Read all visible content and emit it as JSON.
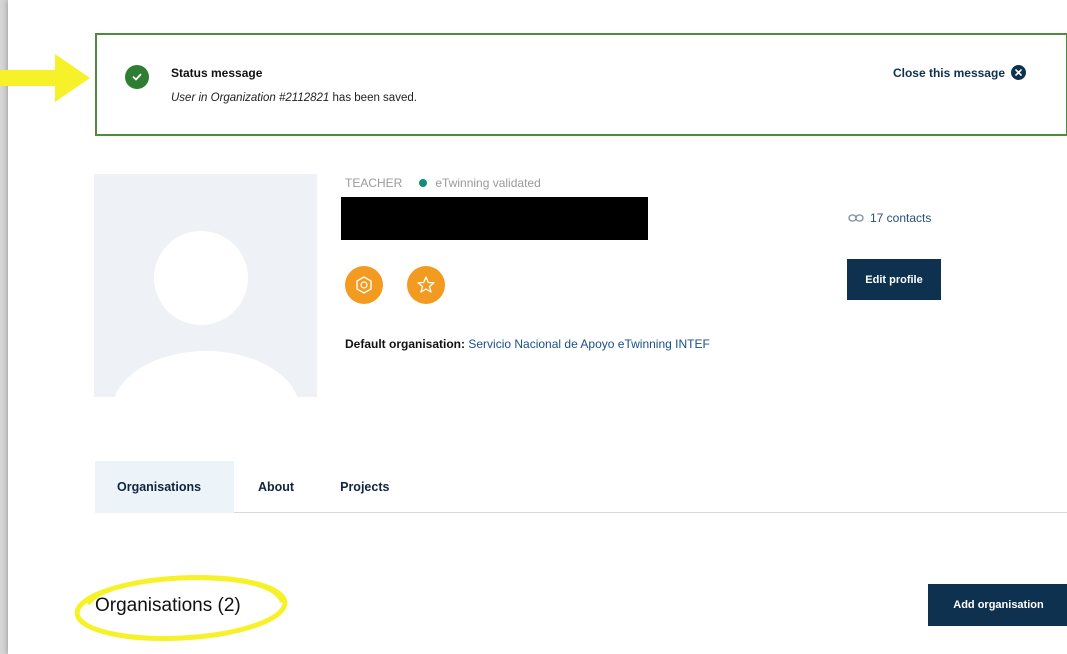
{
  "status": {
    "title": "Status message",
    "text_italic": "User in Organization #2112821",
    "text_rest": " has been saved.",
    "close_label": "Close this message"
  },
  "profile": {
    "role": "TEACHER",
    "validation": "eTwinning validated",
    "contacts": "17 contacts",
    "edit_label": "Edit profile",
    "default_org_label": "Default organisation:",
    "default_org_value": "Servicio Nacional de Apoyo eTwinning INTEF",
    "badges": [
      "hexagon-badge-icon",
      "star-badge-icon"
    ]
  },
  "tabs": [
    {
      "label": "Organisations",
      "active": true
    },
    {
      "label": "About",
      "active": false
    },
    {
      "label": "Projects",
      "active": false
    }
  ],
  "organisations": {
    "heading": "Organisations (2)",
    "add_label": "Add organisation"
  },
  "colors": {
    "accent_dark": "#0f3150",
    "status_border": "#4f8a3f",
    "badge": "#f39a20",
    "validated_dot": "#138d75",
    "annotation": "#f7f12a"
  }
}
